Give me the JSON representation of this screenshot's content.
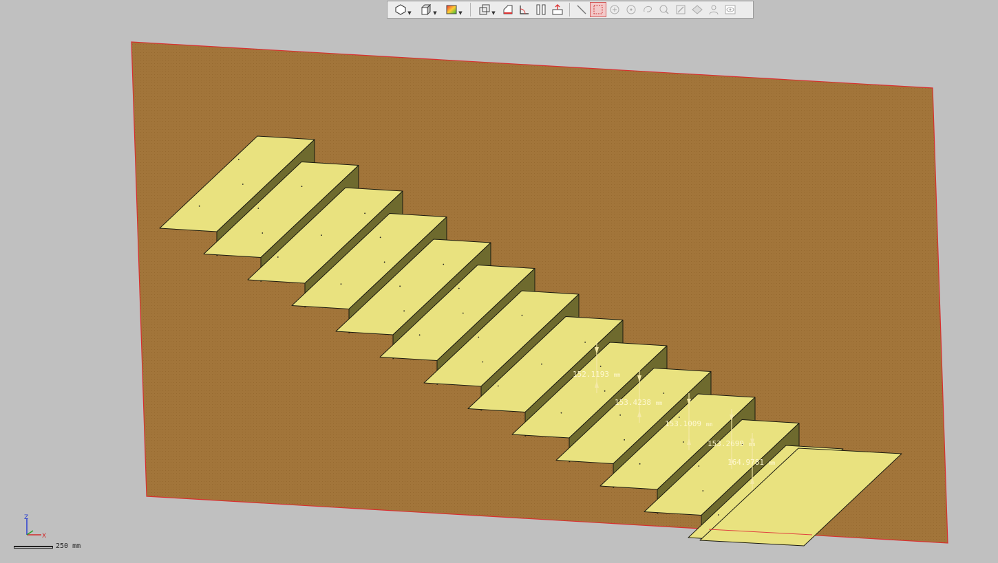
{
  "toolbar": {
    "buttons": [
      {
        "name": "select-mode-icon"
      },
      {
        "name": "view-cube-icon"
      },
      {
        "name": "shading-mode-icon"
      },
      {
        "name": "wireframe-box-icon"
      },
      {
        "name": "section-plane-icon"
      },
      {
        "name": "measure-angle-icon"
      },
      {
        "name": "clip-icon"
      },
      {
        "name": "explode-icon"
      },
      {
        "name": "line-tool-icon"
      },
      {
        "name": "box-select-icon"
      },
      {
        "name": "point-add-icon"
      },
      {
        "name": "point-remove-icon"
      },
      {
        "name": "lasso-icon"
      },
      {
        "name": "pick-icon"
      },
      {
        "name": "edit-icon"
      },
      {
        "name": "surface-icon"
      },
      {
        "name": "person-icon"
      },
      {
        "name": "visibility-icon"
      }
    ]
  },
  "colors": {
    "plane": "#a2753a",
    "plane_edge": "#d83030",
    "tread": "#e9e27f",
    "riser": "#6e6a2e",
    "dimension": "#f4e9a6"
  },
  "measurements": [
    {
      "value": "152.1193",
      "unit": "mm"
    },
    {
      "value": "153.4238",
      "unit": "mm"
    },
    {
      "value": "153.1009",
      "unit": "mm"
    },
    {
      "value": "153.2699",
      "unit": "mm"
    },
    {
      "value": "164.9781",
      "unit": "mm"
    }
  ],
  "scale": {
    "label": "250 mm"
  },
  "axes": {
    "z": "Z",
    "x": "X"
  }
}
